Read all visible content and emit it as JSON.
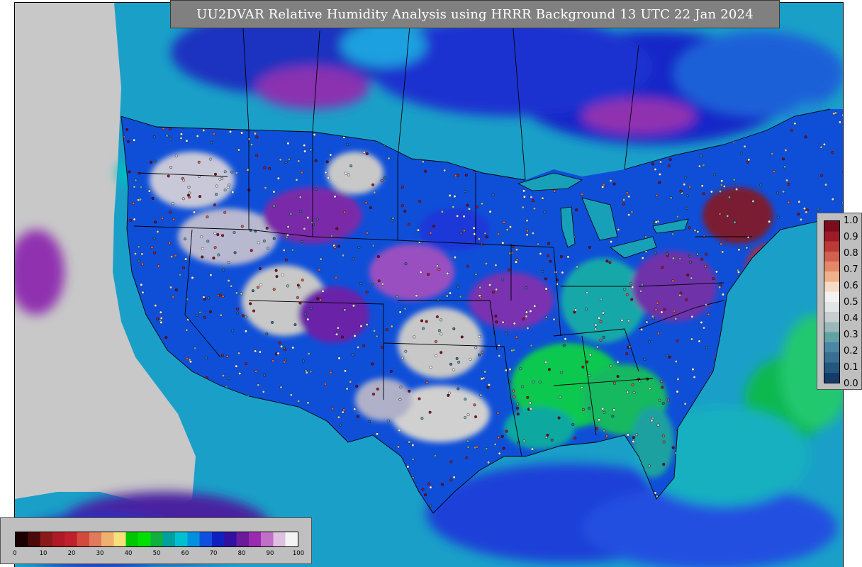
{
  "title": "UU2DVAR Relative Humidity Analysis using HRRR Background 13 UTC 22 Jan 2024",
  "humidity_legend": {
    "ticks": [
      "0",
      "10",
      "20",
      "30",
      "40",
      "50",
      "60",
      "70",
      "80",
      "90",
      "100"
    ],
    "range": [
      0,
      100
    ],
    "colors": [
      "#1a0000",
      "#4a0a0a",
      "#8b1a1a",
      "#b01a28",
      "#c01f2c",
      "#d24a3c",
      "#e07a5a",
      "#f0b070",
      "#f8e07a",
      "#00c800",
      "#00e000",
      "#10b040",
      "#00a0a0",
      "#00c0d0",
      "#0090e0",
      "#1050e0",
      "#1020c0",
      "#3010a0",
      "#6a1a9a",
      "#9a2ab0",
      "#c070c8",
      "#e0c0e0",
      "#f4f4f4"
    ]
  },
  "ratio_legend": {
    "ticks": [
      "0.0",
      "0.1",
      "0.2",
      "0.3",
      "0.4",
      "0.5",
      "0.6",
      "0.7",
      "0.8",
      "0.9",
      "1.0"
    ],
    "range": [
      0,
      1
    ],
    "colors": [
      "#143c6a",
      "#24577f",
      "#3a6f92",
      "#4b86a2",
      "#62a2a4",
      "#9ab8b8",
      "#c8cdd0",
      "#e2e4e6",
      "#f2f2f2",
      "#f6dcc4",
      "#efb08a",
      "#e5886a",
      "#d2604e",
      "#bb3a38",
      "#9e1a28",
      "#7a0c1c"
    ]
  },
  "map_colors": {
    "ocean": "#1aa0c8",
    "land_background": "#0f4fd8",
    "outside_domain": "#c8c8c8",
    "borders": "#000000"
  }
}
